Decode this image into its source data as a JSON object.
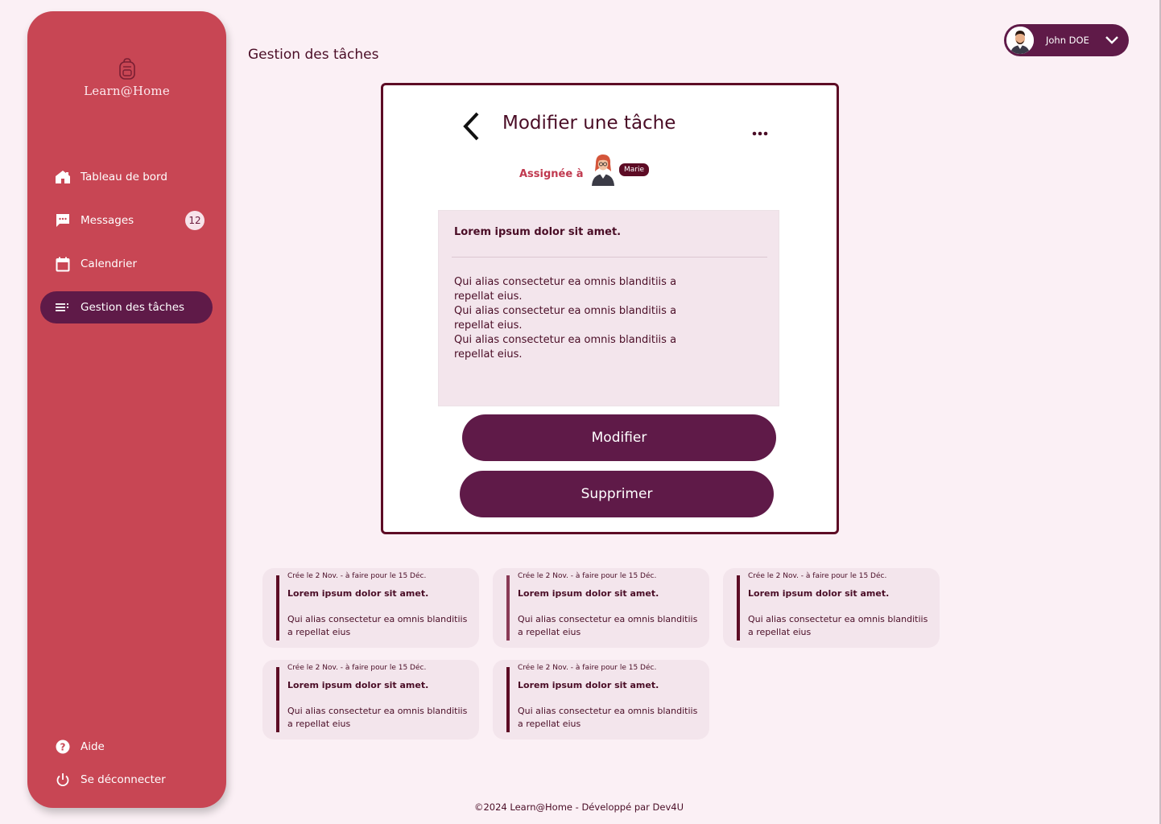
{
  "app": {
    "logo_text": "Learn@Home"
  },
  "sidebar": {
    "items": [
      {
        "label": "Tableau de bord",
        "icon": "home-icon"
      },
      {
        "label": "Messages",
        "icon": "chat-icon",
        "badge": "12"
      },
      {
        "label": "Calendrier",
        "icon": "calendar-icon"
      },
      {
        "label": "Gestion des tâches",
        "icon": "list-icon",
        "active": true
      }
    ],
    "bottom_items": [
      {
        "label": "Aide",
        "icon": "help-icon"
      },
      {
        "label": "Se déconnecter",
        "icon": "power-icon"
      }
    ]
  },
  "header": {
    "page_title": "Gestion des tâches",
    "user": {
      "name": "John DOE"
    }
  },
  "modal": {
    "title": "Modifier une tâche",
    "assigned_label": "Assignée à",
    "assignee_name": "Marie",
    "task_title": "Lorem ipsum dolor sit amet.",
    "task_description": "Qui alias consectetur ea omnis blanditiis a\n repellat eius.\nQui alias consectetur ea omnis blanditiis a\n repellat eius.\nQui alias consectetur ea omnis blanditiis a\n repellat eius.",
    "modify_label": "Modifier",
    "delete_label": "Supprimer"
  },
  "tasks": [
    {
      "meta": "Crée le 2 Nov. - à faire pour le 15 Déc.",
      "title": "Lorem ipsum dolor sit amet.",
      "desc": "Qui alias consectetur ea omnis blanditiis a repellat eius"
    },
    {
      "meta": "Crée le 2 Nov. - à faire pour le 15 Déc.",
      "title": "Lorem ipsum dolor sit amet.",
      "desc": "Qui alias consectetur ea omnis blanditiis a repellat eius"
    },
    {
      "meta": "Crée le 2 Nov. - à faire pour le 15 Déc.",
      "title": "Lorem ipsum dolor sit amet.",
      "desc": "Qui alias consectetur ea omnis blanditiis a repellat eius"
    },
    {
      "meta": "Crée le 2 Nov. - à faire pour le 15 Déc.",
      "title": "Lorem ipsum dolor sit amet.",
      "desc": "Qui alias consectetur ea omnis blanditiis a repellat eius"
    },
    {
      "meta": "Crée le 2 Nov. - à faire pour le 15 Déc.",
      "title": "Lorem ipsum dolor sit amet.",
      "desc": "Qui alias consectetur ea omnis blanditiis a repellat eius"
    }
  ],
  "footer": {
    "text": "©2024 Learn@Home - Développé par Dev4U"
  },
  "colors": {
    "sidebar": "#c84654",
    "accent": "#5f1a48",
    "border": "#5d0c25",
    "background": "#fbf0f5",
    "card": "#f3e5ec"
  }
}
